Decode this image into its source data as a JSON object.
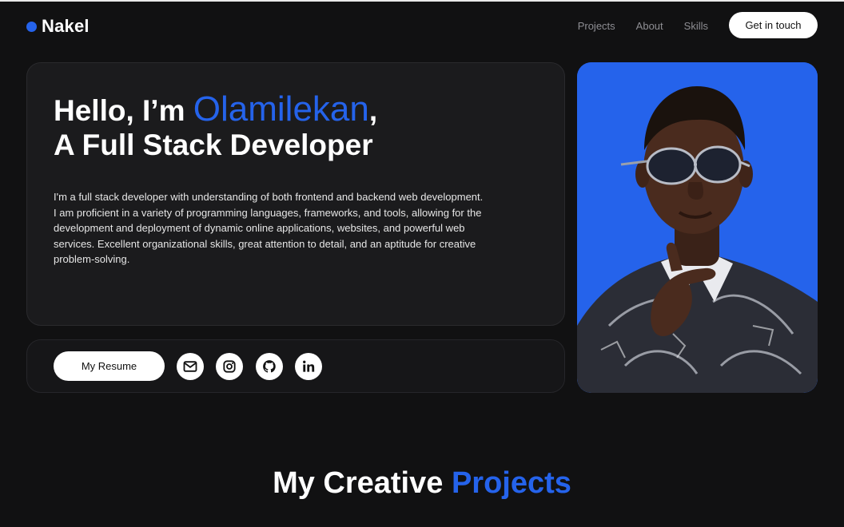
{
  "brand": {
    "name": "Nakel",
    "dot_color": "#2563eb"
  },
  "nav": {
    "links": [
      "Projects",
      "About",
      "Skills"
    ],
    "cta_label": "Get in touch"
  },
  "hero": {
    "greeting": "Hello, I’m ",
    "name": "Olamilekan",
    "comma": ",",
    "role": "A Full Stack Developer",
    "description": "I'm a full stack developer with understanding of both frontend and backend web development. I am proficient in a variety of programming languages, frameworks, and tools, allowing for the development and deployment of dynamic online applications, websites, and powerful web services. Excellent organizational skills, great attention to detail, and an aptitude for creative problem-solving."
  },
  "actions": {
    "resume_label": "My Resume",
    "socials": [
      "mail-icon",
      "instagram-icon",
      "github-icon",
      "linkedin-icon"
    ]
  },
  "section": {
    "title_plain": "My Creative ",
    "title_accent": "Projects"
  },
  "colors": {
    "accent": "#2563eb",
    "background": "#111112",
    "card": "#1b1b1d"
  }
}
